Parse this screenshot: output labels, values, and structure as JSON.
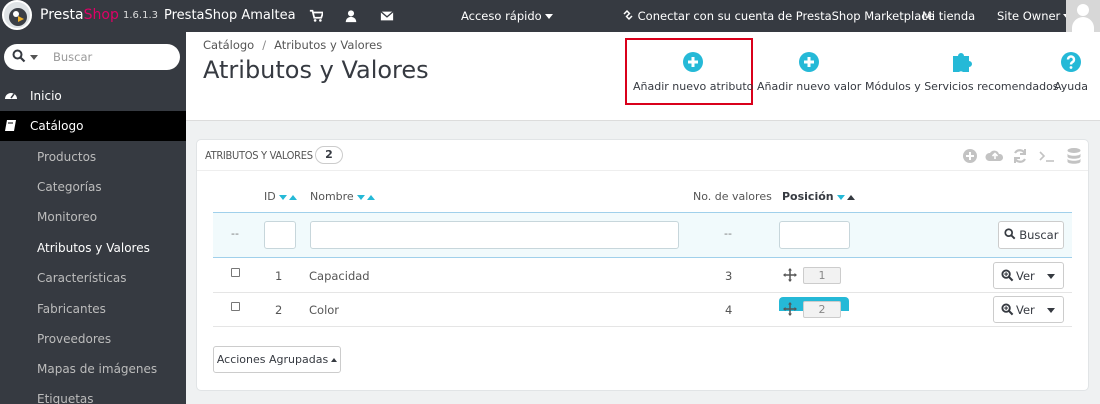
{
  "topbar": {
    "brand_a": "Presta",
    "brand_b": "Shop",
    "version": "1.6.1.3",
    "shop_name": "PrestaShop Amaltea",
    "quick_access": "Acceso rápido",
    "marketplace": "Conectar con su cuenta de PrestaShop Marketplace",
    "my_shop": "Mi tienda",
    "user": "Site Owner"
  },
  "sidebar": {
    "search_placeholder": "Buscar",
    "home": "Inicio",
    "catalog": "Catálogo",
    "items": [
      {
        "label": "Productos"
      },
      {
        "label": "Categorías"
      },
      {
        "label": "Monitoreo"
      },
      {
        "label": "Atributos y Valores"
      },
      {
        "label": "Características"
      },
      {
        "label": "Fabricantes"
      },
      {
        "label": "Proveedores"
      },
      {
        "label": "Mapas de imágenes"
      },
      {
        "label": "Etiquetas"
      }
    ]
  },
  "header": {
    "breadcrumb_1": "Catálogo",
    "breadcrumb_sep": "/",
    "breadcrumb_2": "Atributos y Valores",
    "title": "Atributos y Valores",
    "buttons": {
      "add_attribute": "Añadir nuevo atributo",
      "add_value": "Añadir nuevo valor",
      "modules": "Módulos y Servicios recomendados",
      "help": "Ayuda"
    }
  },
  "panel": {
    "title": "Atributos y Valores",
    "count": "2",
    "columns": {
      "id": "ID",
      "name": "Nombre",
      "values": "No. de valores",
      "position": "Posición"
    },
    "filter_dash_1": "--",
    "filter_dash_2": "--",
    "search_button": "Buscar",
    "rows": [
      {
        "id": "1",
        "name": "Capacidad",
        "values": "3",
        "position": "1",
        "view": "Ver"
      },
      {
        "id": "2",
        "name": "Color",
        "values": "4",
        "position": "2",
        "view": "Ver"
      }
    ],
    "bulk_actions": "Acciones Agrupadas"
  },
  "colors": {
    "topbar": "#363a41",
    "accent": "#25b9d7",
    "brand_pink": "#df0067",
    "highlight_border": "#d9001b"
  }
}
